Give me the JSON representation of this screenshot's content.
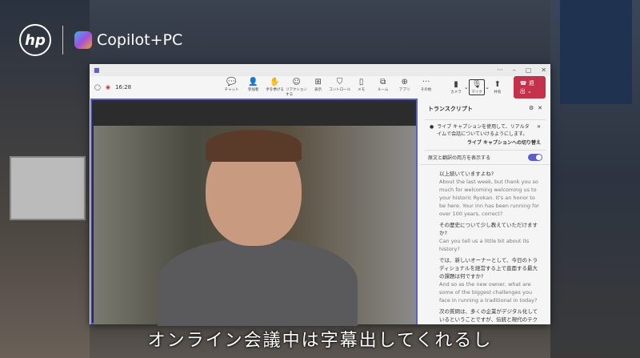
{
  "brand": {
    "hp": "hp",
    "copilot": "Copilot+PC"
  },
  "window": {
    "title_controls": [
      "···",
      "–",
      "▢",
      "✕"
    ]
  },
  "toolbar": {
    "time": "16:28",
    "participants_count": "2",
    "tools": [
      {
        "label": "チャット",
        "icon": "chat-icon",
        "glyph": "💬"
      },
      {
        "label": "参加者",
        "icon": "people-icon",
        "glyph": "👤"
      },
      {
        "label": "手を挙げる",
        "icon": "hand-icon",
        "glyph": "✋"
      },
      {
        "label": "リアクションする",
        "icon": "smile-icon",
        "glyph": "☺"
      },
      {
        "label": "表示",
        "icon": "grid-icon",
        "glyph": "⊞"
      },
      {
        "label": "コントロール",
        "icon": "shield-icon",
        "glyph": "⛉"
      },
      {
        "label": "メモ",
        "icon": "notes-icon",
        "glyph": "▯"
      },
      {
        "label": "ルーム",
        "icon": "rooms-icon",
        "glyph": "⧉"
      },
      {
        "label": "アプリ",
        "icon": "apps-icon",
        "glyph": "⊕"
      },
      {
        "label": "その他",
        "icon": "more-icon",
        "glyph": "···"
      }
    ],
    "camera": "カメラ",
    "mic": "マイク",
    "share": "共有",
    "leave": "退出"
  },
  "transcript": {
    "title": "トランスクリプト",
    "notice": "ライブ キャプションを使用して、リアルタイムで会話についていけるようにします。",
    "switch_link": "ライブ キャプションへの切り替え",
    "toggle_label": "原文と翻訳の両方を表示する",
    "toggle_on": true,
    "entries": [
      {
        "ja": "以上続いていますよね?",
        "en": "About the last week, but thank you so much for welcoming welcoming us to your historic Ryokan. It's an honor to be here. Your inn has been running for over 100 years, correct?"
      },
      {
        "ja": "その歴史について少し教えていただけますか?",
        "en": "Can you tell us a little bit about its history?"
      },
      {
        "ja": "では、新しいオーナーとして、今日のトラディショナルを経営する上で直面する最大の課題は何ですか?",
        "en": "And so as the new owner, what are some of the biggest challenges you face in running a traditional in today?"
      },
      {
        "ja": "次の質問は、多くの企業がデジタル化しているということですが、伝統と現代のテクノロジーのバランスをどのようにとるのでしょうか?",
        "en": "My next question is many businesses are going digital, so how do you balance"
      }
    ]
  },
  "subtitle": "オンライン会議中は字幕出してくれるし",
  "colors": {
    "accent": "#5b5fc7",
    "leave": "#c4314b"
  }
}
